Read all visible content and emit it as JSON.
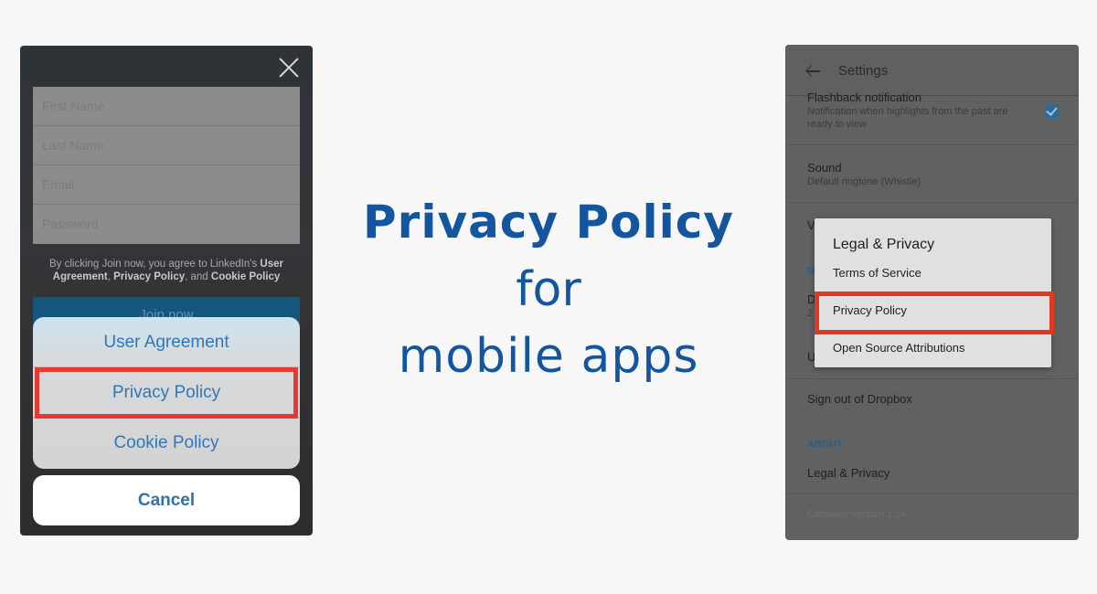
{
  "title": {
    "line1": "Privacy Policy",
    "line2": "for",
    "line3": "mobile apps",
    "color": "#14559f"
  },
  "left_phone": {
    "close_icon": "close-icon",
    "form": {
      "fields": [
        {
          "placeholder": "First Name"
        },
        {
          "placeholder": "Last Name"
        },
        {
          "placeholder": "Email"
        },
        {
          "placeholder": "Password"
        }
      ]
    },
    "agreement": {
      "prefix": "By clicking Join now, you agree to LinkedIn's ",
      "link1": "User Agreement",
      "sep1": ", ",
      "link2": "Privacy Policy",
      "sep2": ", and ",
      "link3": "Cookie Policy"
    },
    "join_button": "Join now",
    "action_sheet": {
      "items": [
        {
          "label": "User Agreement"
        },
        {
          "label": "Privacy Policy",
          "highlighted": true
        },
        {
          "label": "Cookie Policy"
        }
      ],
      "cancel": "Cancel"
    },
    "highlight_color": "#e43a33",
    "link_color": "#2f77b8"
  },
  "right_phone": {
    "app_bar": {
      "back_icon": "back-arrow-icon",
      "title": "Settings"
    },
    "settings": [
      {
        "label": "Flashback notification",
        "sub": "Notification when highlights from the past are ready to view",
        "checked": true
      },
      {
        "label": "Sound",
        "sub": "Default ringtone (Whistle)"
      },
      {
        "label_partial": "V"
      },
      {
        "section_partial": "D"
      },
      {
        "label_partial": "D",
        "sub_partial": "2"
      },
      {
        "label_partial": "U"
      },
      {
        "label": "Sign out of Dropbox"
      }
    ],
    "about_section": {
      "header": "ABOUT",
      "items": [
        {
          "label": "Legal & Privacy"
        }
      ],
      "version": "Carousel Version 1.14"
    },
    "dialog": {
      "title": "Legal & Privacy",
      "items": [
        {
          "label": "Terms of Service"
        },
        {
          "label": "Privacy Policy",
          "highlighted": true
        },
        {
          "label": "Open Source Attributions"
        }
      ]
    },
    "highlight_color": "#e0391f"
  }
}
